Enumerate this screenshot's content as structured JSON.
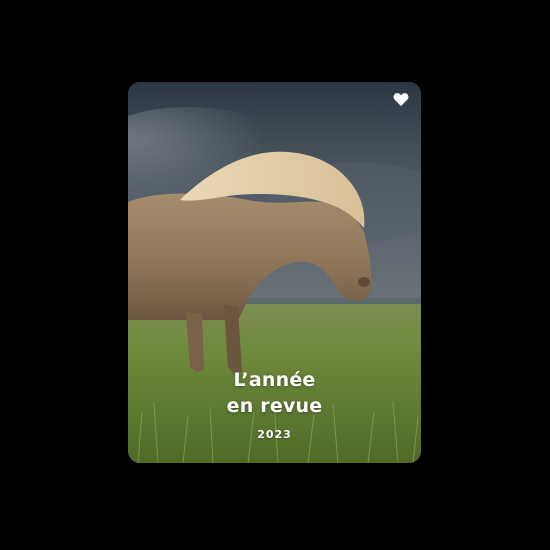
{
  "card": {
    "title_line1": "L’année",
    "title_line2": "en revue",
    "year": "2023",
    "favorite_icon": "heart-icon",
    "photo_subject": "horse-in-grass-field"
  },
  "colors": {
    "background": "#000000",
    "text": "#ffffff",
    "sky": "#3b4652",
    "grass": "#6f8a3c"
  }
}
